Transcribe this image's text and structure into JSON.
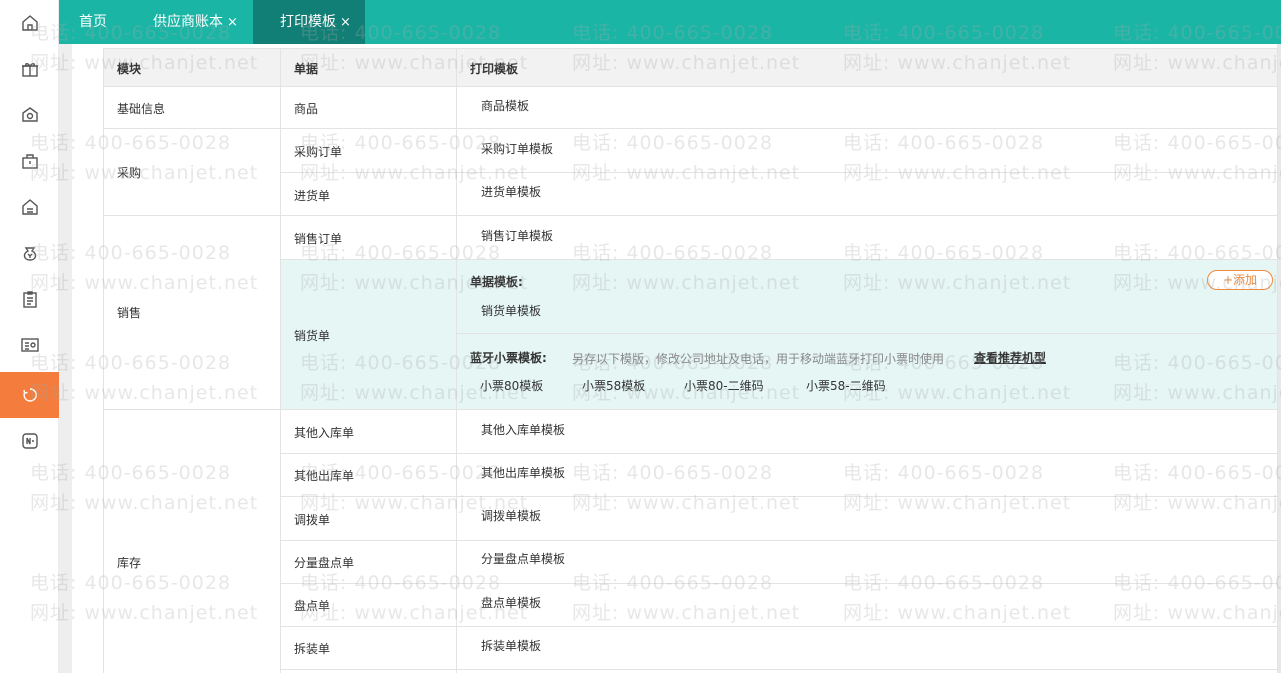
{
  "nav": {
    "icons": [
      "home-icon",
      "gift-icon",
      "box-icon",
      "shopping-bag-icon",
      "warehouse-icon",
      "money-bag-icon",
      "clipboard-icon",
      "id-card-icon",
      "loading-icon",
      "new-badge-icon"
    ],
    "active_index": 8
  },
  "tabs": [
    {
      "label": "首页",
      "closable": false
    },
    {
      "label": "供应商账本",
      "closable": true
    },
    {
      "label": "打印模板",
      "closable": true
    }
  ],
  "close_glyph": "×",
  "watermark": {
    "phone": "电话: 400-665-0028",
    "site": "网址: www.chanjet.net"
  },
  "table": {
    "headers": [
      "模块",
      "单据",
      "打印模板"
    ],
    "modules": [
      "基础信息",
      "采购",
      "销售",
      "库存"
    ],
    "rows": [
      {
        "doc": "商品",
        "template": "商品模板"
      },
      {
        "doc": "采购订单",
        "template": "采购订单模板"
      },
      {
        "doc": "进货单",
        "template": "进货单模板"
      },
      {
        "doc": "销售订单",
        "template": "销售订单模板"
      },
      {
        "doc": "销货单",
        "template": ""
      },
      {
        "doc": "其他入库单",
        "template": "其他入库单模板"
      },
      {
        "doc": "其他出库单",
        "template": "其他出库单模板"
      },
      {
        "doc": "调拨单",
        "template": "调拨单模板"
      },
      {
        "doc": "分量盘点单",
        "template": "分量盘点单模板"
      },
      {
        "doc": "盘点单",
        "template": "盘点单模板"
      },
      {
        "doc": "拆装单",
        "template": "拆装单模板"
      }
    ],
    "sales_detail": {
      "doc_template_title": "单据模板:",
      "doc_template_item": "销货单模板",
      "add_label": "+添加",
      "bt_title": "蓝牙小票模板:",
      "bt_note": "另存以下模版，修改公司地址及电话，用于移动端蓝牙打印小票时使用",
      "bt_link": "查看推荐机型",
      "bt_items": [
        "小票80模板",
        "小票58模板",
        "小票80-二维码",
        "小票58-二维码"
      ]
    }
  },
  "colors": {
    "accent": "#1bb5a6",
    "active_tab": "#117f76",
    "orange": "#f47c3c",
    "highlight_row": "#e5f6f4"
  }
}
